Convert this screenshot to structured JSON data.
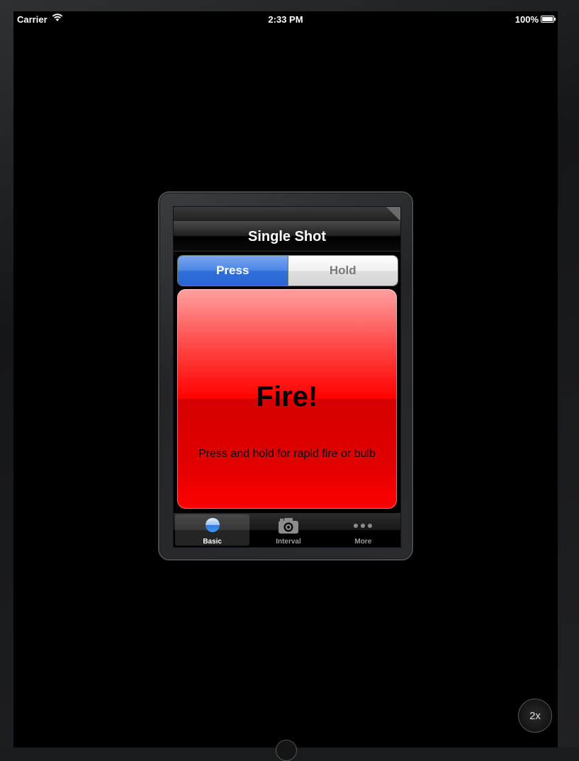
{
  "status_bar": {
    "carrier": "Carrier",
    "time": "2:33 PM",
    "battery": "100%"
  },
  "app": {
    "nav_title": "Single Shot",
    "segments": {
      "press": "Press",
      "hold": "Hold",
      "selected": "Press"
    },
    "fire_button": {
      "label": "Fire!",
      "hint": "Press and hold for rapid fire or bulb"
    },
    "tabs": [
      {
        "label": "Basic",
        "icon": "circle-icon",
        "active": true
      },
      {
        "label": "Interval",
        "icon": "camera-icon",
        "active": false
      },
      {
        "label": "More",
        "icon": "more-icon",
        "active": false
      }
    ]
  },
  "simulator": {
    "zoom_label": "2x"
  },
  "colors": {
    "segment_active": "#4a85e6",
    "fire_button": "#ff0000",
    "background": "#000000"
  }
}
